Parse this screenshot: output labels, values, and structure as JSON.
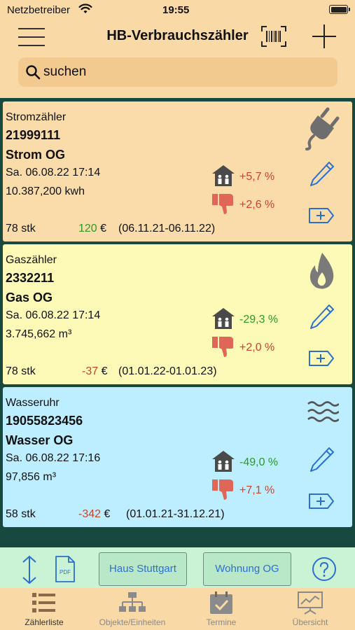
{
  "status_bar": {
    "carrier": "Netzbetreiber",
    "time": "19:55"
  },
  "nav": {
    "title": "HB-Verbrauchszähler",
    "menu_icon": "hamburger-menu-icon",
    "barcode_icon": "barcode-scan-icon",
    "add_icon": "plus-icon"
  },
  "search": {
    "placeholder": "suchen"
  },
  "cards": [
    {
      "type": "Stromzähler",
      "number": "21999111",
      "name": "Strom OG",
      "date": "Sa. 06.08.22  17:14",
      "reading": "10.387,200 kwh",
      "house_cmp": "+5,7 %",
      "thumb_cmp": "+2,6 %",
      "count": "78 stk",
      "cost_value": "120",
      "currency": "€",
      "period": "(06.11.21-06.11.22)",
      "type_icon": "plug-icon",
      "bg_color": "#fadcaa"
    },
    {
      "type": "Gaszähler",
      "number": "2332211",
      "name": "Gas OG",
      "date": "Sa. 06.08.22  17:14",
      "reading": "3.745,662 m³",
      "house_cmp": "-29,3 %",
      "thumb_cmp": "+2,0 %",
      "count": "78 stk",
      "cost_value": "-37",
      "currency": "€",
      "period": "(01.01.22-01.01.23)",
      "type_icon": "flame-icon",
      "bg_color": "#fcfab6"
    },
    {
      "type": "Wasseruhr",
      "number": "19055823456",
      "name": "Wasser OG",
      "date": "Sa. 06.08.22  17:16",
      "reading": "97,856 m³",
      "house_cmp": "-49,0 %",
      "thumb_cmp": "+7,1 %",
      "count": "58 stk",
      "cost_value": "-342",
      "currency": "€",
      "period": "(01.01.21-31.12.21)",
      "type_icon": "water-waves-icon",
      "bg_color": "#bdeeff"
    }
  ],
  "toolbar": {
    "chip_object": "Haus Stuttgart",
    "chip_unit": "Wohnung OG",
    "pdf_label": "PDF"
  },
  "tabs": [
    {
      "label": "Zählerliste",
      "icon": "list-icon"
    },
    {
      "label": "Objekte/Einheiten",
      "icon": "hierarchy-icon"
    },
    {
      "label": "Termine",
      "icon": "calendar-check-icon"
    },
    {
      "label": "Übersicht",
      "icon": "presentation-chart-icon"
    }
  ],
  "colors": {
    "accent_blue": "#2b6fd1",
    "positive_green": "#2a9a24",
    "negative_red": "#c8452b",
    "list_bg": "#17493e"
  }
}
